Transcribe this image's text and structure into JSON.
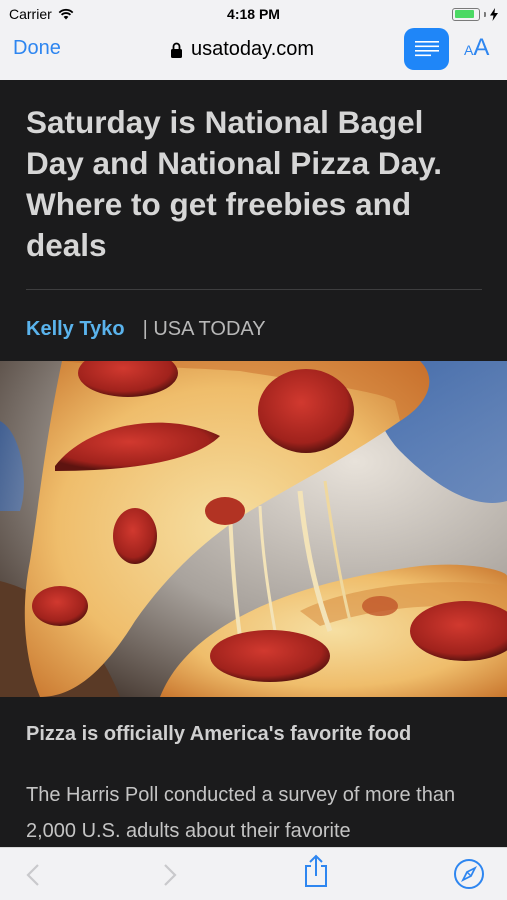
{
  "status_bar": {
    "carrier": "Carrier",
    "time": "4:18 PM",
    "battery_level": 0.85
  },
  "nav_bar": {
    "done_label": "Done",
    "url": "usatoday.com",
    "text_size_small": "A",
    "text_size_large": "A"
  },
  "article": {
    "headline": "Saturday is National Bagel Day and National Pizza Day. Where to get freebies and deals",
    "author": "Kelly Tyko",
    "source": "| USA TODAY",
    "subhead": "Pizza is officially America's favorite food",
    "body": "The Harris Poll conducted a survey of more than 2,000 U.S. adults about their favorite"
  },
  "toolbar": {
    "back_icon": "chevron-left-icon",
    "forward_icon": "chevron-right-icon",
    "share_icon": "share-icon",
    "safari_icon": "compass-icon"
  },
  "colors": {
    "accent": "#2e86f0",
    "author": "#5ab3ec",
    "background": "#1b1b1c"
  }
}
